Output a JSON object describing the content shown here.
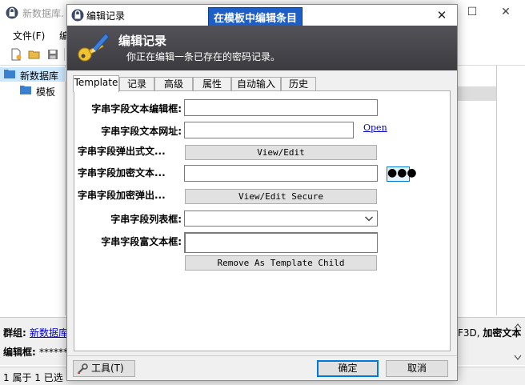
{
  "main_window": {
    "title": "新数据库.",
    "menu": [
      "文件(F)",
      "编"
    ],
    "tree": [
      {
        "label": "新数据库",
        "selected": true
      },
      {
        "label": "模板",
        "selected": false
      }
    ],
    "info": {
      "group_label": "群组:",
      "group_link": "新数据库",
      "field_label": "编辑框:",
      "field_value": "*******",
      "right_text": "F3D,",
      "right_bold": "加密文本"
    },
    "status": "1 属于 1 已选"
  },
  "dialog": {
    "title": "编辑记录",
    "callout": "在模板中编辑条目",
    "banner": {
      "title": "编辑记录",
      "subtitle": "你正在编辑一条已存在的密码记录。"
    },
    "tabs": [
      "Template",
      "记录",
      "高级",
      "属性",
      "自动输入",
      "历史"
    ],
    "active_tab": "Template",
    "fields": {
      "text_edit_label": "字串字段文本编辑框:",
      "url_label": "字串字段文本网址:",
      "open_link": "Open",
      "popup_label": "字串字段弹出式文...",
      "view_edit_btn": "View/Edit",
      "encrypted_label": "字串字段加密文本...",
      "password_dots": "●●●",
      "encrypted_popup_label": "字串字段加密弹出...",
      "view_edit_secure_btn": "View/Edit Secure",
      "list_label": "字串字段列表框:",
      "richtext_label": "字串字段富文本框:",
      "remove_child_btn": "Remove As Template Child"
    },
    "buttons": {
      "tools": "工具(T)",
      "ok": "确定",
      "cancel": "取消"
    }
  },
  "colors": {
    "banner": "#48484d",
    "callout": "#1e5fc7",
    "tree_selection": "#cce8ff",
    "link": "#0000cc"
  }
}
